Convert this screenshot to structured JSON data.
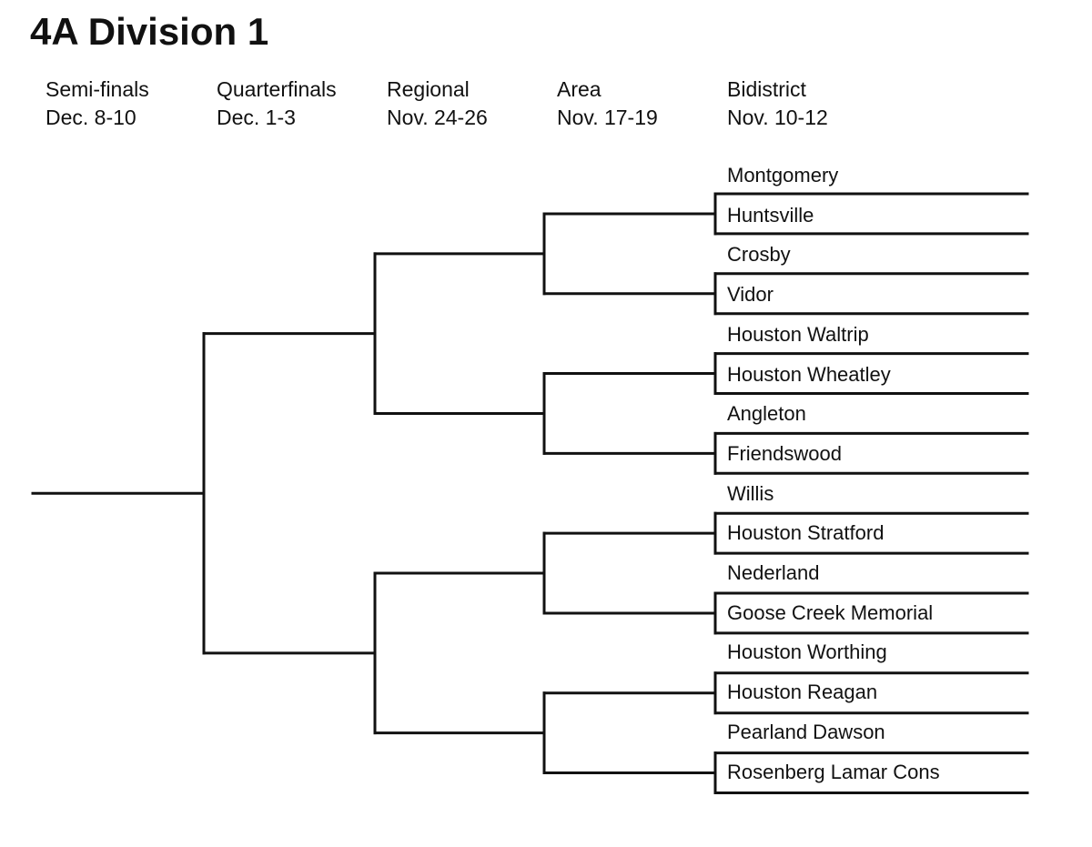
{
  "title": "4A Division 1",
  "rounds": [
    {
      "name": "Semi-finals",
      "dates": "Dec. 8-10"
    },
    {
      "name": "Quarterfinals",
      "dates": "Dec. 1-3"
    },
    {
      "name": "Regional",
      "dates": "Nov. 24-26"
    },
    {
      "name": "Area",
      "dates": "Nov. 17-19"
    },
    {
      "name": "Bidistrict",
      "dates": "Nov. 10-12"
    }
  ],
  "bidistrict_matchups": [
    {
      "team_a": "Montgomery",
      "team_b": "Huntsville"
    },
    {
      "team_a": "Crosby",
      "team_b": "Vidor"
    },
    {
      "team_a": "Houston Waltrip",
      "team_b": "Houston Wheatley"
    },
    {
      "team_a": "Angleton",
      "team_b": "Friendswood"
    },
    {
      "team_a": "Willis",
      "team_b": "Houston Stratford"
    },
    {
      "team_a": "Nederland",
      "team_b": "Goose Creek Memorial"
    },
    {
      "team_a": "Houston Worthing",
      "team_b": "Houston Reagan"
    },
    {
      "team_a": "Pearland Dawson",
      "team_b": "Rosenberg Lamar Cons"
    }
  ],
  "teams": [
    "Montgomery",
    "Huntsville",
    "Crosby",
    "Vidor",
    "Houston Waltrip",
    "Houston Wheatley",
    "Angleton",
    "Friendswood",
    "Willis",
    "Houston Stratford",
    "Nederland",
    "Goose Creek Memorial",
    "Houston Worthing",
    "Houston Reagan",
    "Pearland Dawson",
    "Rosenberg Lamar Cons"
  ]
}
